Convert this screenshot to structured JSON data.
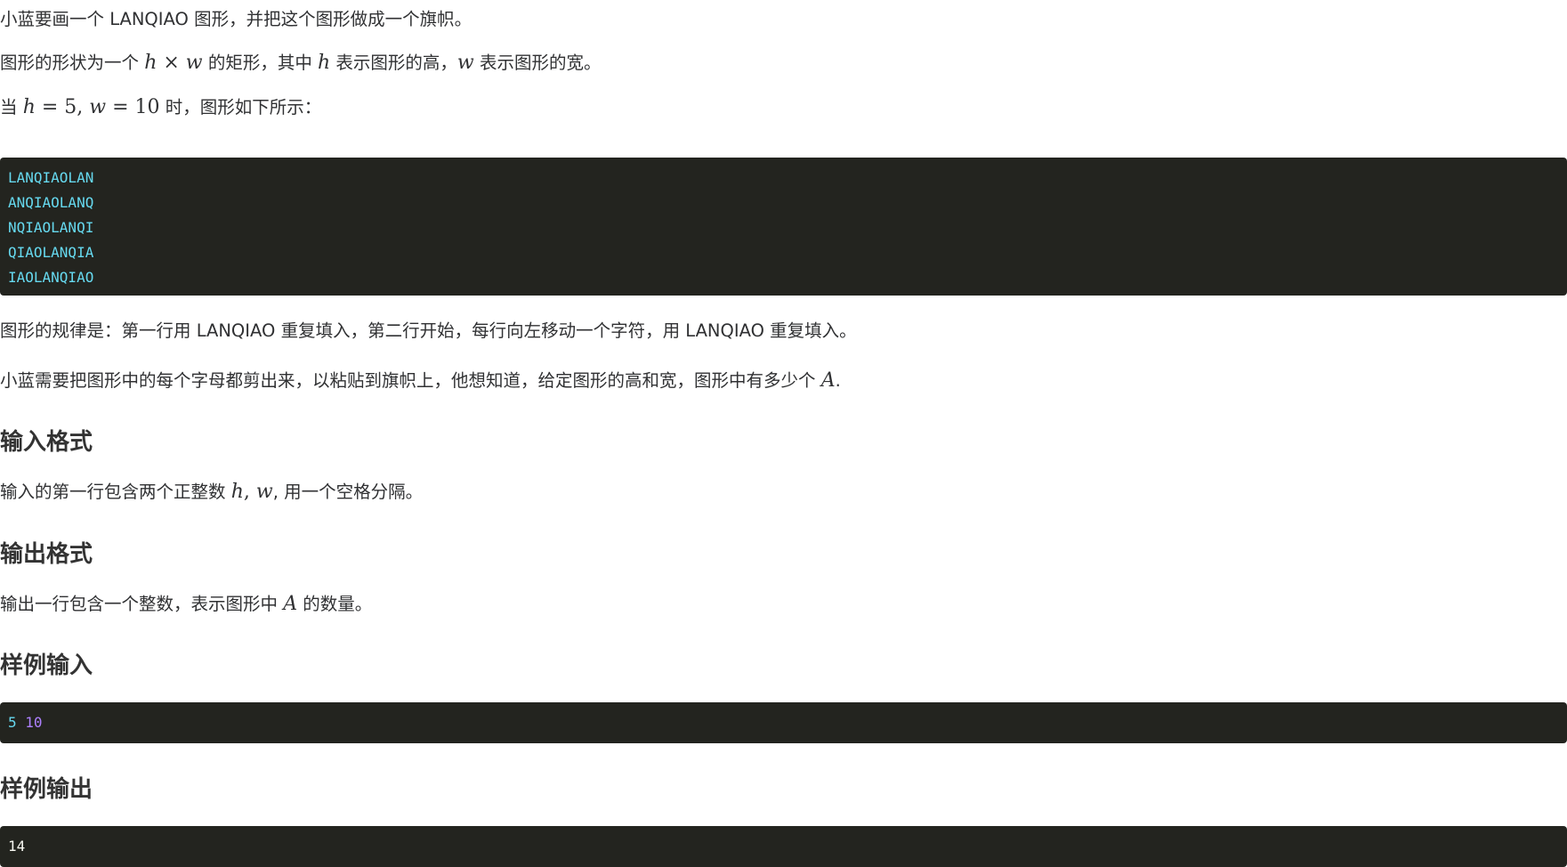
{
  "statement": {
    "p1": "小蓝要画一个 LANQIAO 图形，并把这个图形做成一个旗帜。",
    "p2": {
      "a": "图形的形状为一个 ",
      "m1": "h",
      "times": " × ",
      "m2": "w",
      "b": " 的矩形，其中 ",
      "m3": "h",
      "c": " 表示图形的高，",
      "m4": "w",
      "d": " 表示图形的宽。"
    },
    "p3": {
      "a": "当 ",
      "m1": "h",
      "eq1": " = 5, ",
      "m2": "w",
      "eq2": " = 10",
      "b": " 时，图形如下所示："
    },
    "figure_lines": [
      "LANQIAOLAN",
      "ANQIAOLANQ",
      "NQIAOLANQI",
      "QIAOLANQIA",
      "IAOLANQIAO"
    ],
    "p4": "图形的规律是：第一行用 LANQIAO 重复填入，第二行开始，每行向左移动一个字符，用 LANQIAO 重复填入。",
    "p5": {
      "a": "小蓝需要把图形中的每个字母都剪出来，以粘贴到旗帜上，他想知道，给定图形的高和宽，图形中有多少个 ",
      "m1": "A",
      "b": "."
    }
  },
  "input_section": {
    "heading": "输入格式",
    "text": {
      "a": "输入的第一行包含两个正整数 ",
      "m1": "h",
      "comma": ", ",
      "m2": "w",
      "b": ", 用一个空格分隔。"
    }
  },
  "output_section": {
    "heading": "输出格式",
    "text": {
      "a": "输出一行包含一个整数，表示图形中 ",
      "m1": "A",
      "b": " 的数量。"
    }
  },
  "sample_input": {
    "heading": "样例输入",
    "h": "5",
    "w": "10"
  },
  "sample_output": {
    "heading": "样例输出",
    "value": "14"
  },
  "colors": {
    "code_background": "#23241f",
    "code_identifier": "#66d9ef",
    "code_number": "#ae81ff",
    "code_plain": "#f8f8f2",
    "body_text": "#303133"
  }
}
